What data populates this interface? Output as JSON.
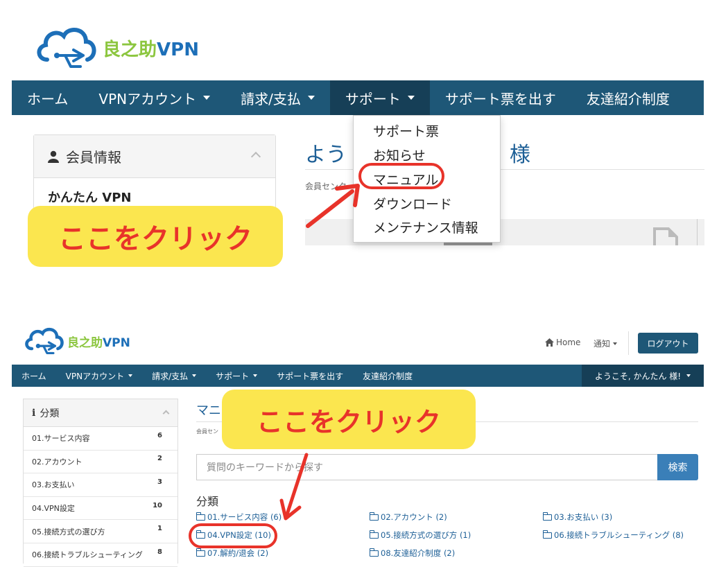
{
  "brand": {
    "name_jp": "良之助",
    "name_en": "VPN"
  },
  "colors": {
    "nav": "#1e5777",
    "nav_active": "#163f57",
    "callout_bg": "#fbe64f",
    "callout_text": "#e8332a",
    "highlight_ring": "#e8332a",
    "link": "#1d5f96",
    "button": "#3a7fb8"
  },
  "top": {
    "nav": [
      {
        "label": "ホーム",
        "caret": false
      },
      {
        "label": "VPNアカウント",
        "caret": true
      },
      {
        "label": "請求/支払",
        "caret": true
      },
      {
        "label": "サポート",
        "caret": true,
        "active": true
      },
      {
        "label": "サポート票を出す",
        "caret": false
      },
      {
        "label": "友達紹介制度",
        "caret": false
      }
    ],
    "panel": {
      "icon": "user-icon",
      "title": "会員情報",
      "username": "かんたん VPN"
    },
    "heading_left": "よう",
    "heading_right": "様",
    "breadcrumb": "会員センタ",
    "dropdown": [
      "サポート票",
      "お知らせ",
      "マニュアル",
      "ダウンロード",
      "メンテナンス情報"
    ],
    "callout": "ここをクリック"
  },
  "bottom": {
    "header": {
      "home_icon": "home-icon",
      "home": "Home",
      "notify": "通知",
      "logout": "ログアウト"
    },
    "nav": [
      {
        "label": "ホーム",
        "caret": false
      },
      {
        "label": "VPNアカウント",
        "caret": true
      },
      {
        "label": "請求/支払",
        "caret": true
      },
      {
        "label": "サポート",
        "caret": true
      },
      {
        "label": "サポート票を出す",
        "caret": false
      },
      {
        "label": "友達紹介制度",
        "caret": false
      }
    ],
    "welcome": "ようこそ, かんたん 様!",
    "sidebar": {
      "icon": "info-icon",
      "title": "分類",
      "items": [
        {
          "label": "01.サービス内容",
          "count": "6"
        },
        {
          "label": "02.アカウント",
          "count": "2"
        },
        {
          "label": "03.お支払い",
          "count": "3"
        },
        {
          "label": "04.VPN設定",
          "count": "10"
        },
        {
          "label": "05.接続方式の選び方",
          "count": "1"
        },
        {
          "label": "06.接続トラブルシューティング",
          "count": "8"
        }
      ]
    },
    "heading": "マニ",
    "breadcrumb": "会員セン",
    "search": {
      "placeholder": "質問のキーワードから探す",
      "button": "検索"
    },
    "categories_title": "分類",
    "categories": [
      "01.サービス内容 (6)",
      "02.アカウント (2)",
      "03.お支払い (3)",
      "04.VPN設定 (10)",
      "05.接続方式の選び方 (1)",
      "06.接続トラブルシューティング (8)",
      "07.解約/退会 (2)",
      "08.友達紹介制度 (2)"
    ],
    "callout": "ここをクリック"
  }
}
